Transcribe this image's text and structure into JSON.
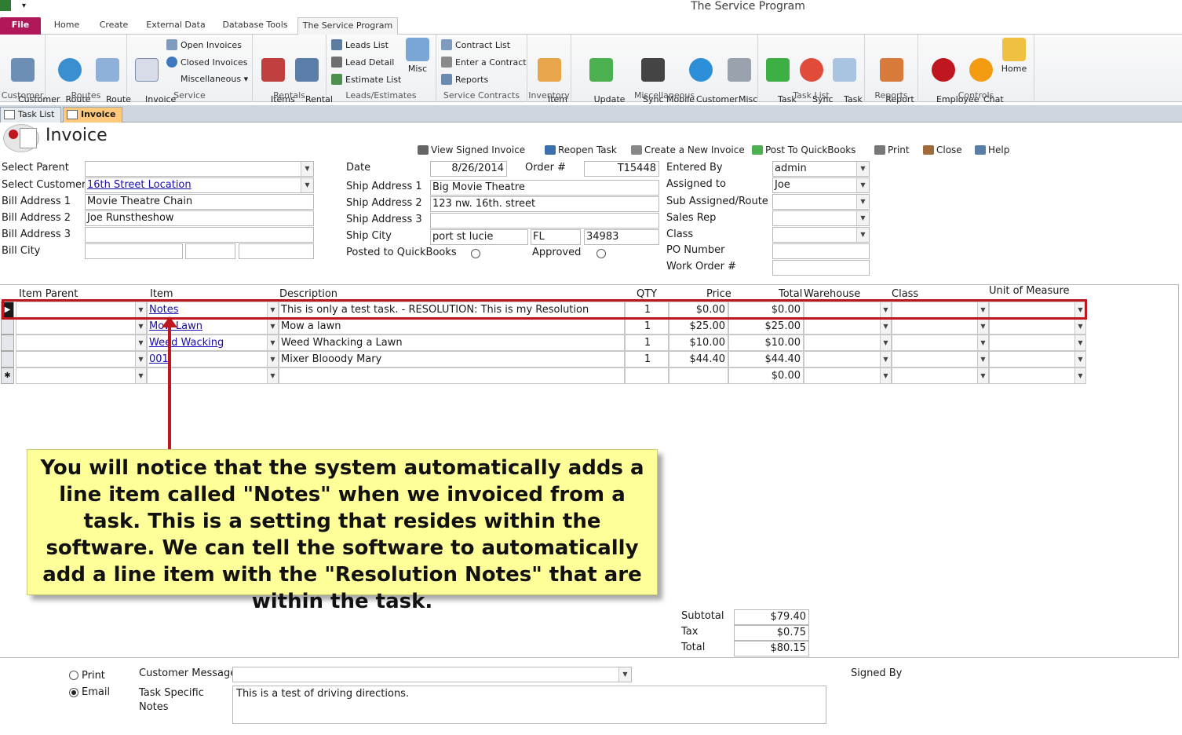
{
  "window": {
    "title": "The Service Program"
  },
  "ribbon_tabs": [
    "File",
    "Home",
    "Create",
    "External Data",
    "Database Tools",
    "The Service Program"
  ],
  "ribbon": {
    "customer": {
      "label": "Customer",
      "btn": "Customer\nInfo ▾"
    },
    "routes": {
      "label": "Routes",
      "schedule": "Route\nSchedule",
      "info": "Route\nInfo ▾"
    },
    "service": {
      "label": "Service",
      "invoice_entry": "Invoice\nEntry",
      "open_invoices": "Open Invoices",
      "closed_invoices": "Closed Invoices",
      "misc": "Miscellaneous ▾"
    },
    "rentals": {
      "label": "Rentals",
      "items_rented": "Items\nRented",
      "rental_info": "Rental\nInfo ▾"
    },
    "leads": {
      "label": "Leads/Estimates",
      "leads_list": "Leads List",
      "lead_detail": "Lead Detail",
      "estimate_list": "Estimate List",
      "misc": "Misc"
    },
    "contracts": {
      "label": "Service Contracts",
      "contract_list": "Contract List",
      "enter_contract": "Enter a Contract",
      "reports": "Reports"
    },
    "inventory": {
      "label": "Inventory",
      "item_info": "Item\nInfo ▾"
    },
    "miscellaneous": {
      "label": "Miscellaneous",
      "update_qb": "Update\nQuickBooks",
      "sync_mobile": "Sync Mobile\nDevices",
      "customer_portal": "Customer\nPortal",
      "misc_info": "Misc\nInfo ▾"
    },
    "tasklist": {
      "label": "Task List",
      "task_entry": "Task\nEntry",
      "sync_gcals": "Sync\ngCals",
      "task_info": "Task\nInfo ▾"
    },
    "reports": {
      "label": "Reports",
      "report_selection": "Report\nSelection ▾"
    },
    "controls": {
      "label": "Controls",
      "employee_locator": "Employee\nLocator",
      "chat_now": "Chat\nNow",
      "home": "Home"
    }
  },
  "doc_tabs": [
    "Task List",
    "Invoice"
  ],
  "form": {
    "title": "Invoice",
    "toolbar": {
      "view_signed": "View Signed Invoice",
      "reopen_task": "Reopen Task",
      "create_new": "Create a New Invoice",
      "post_qb": "Post To QuickBooks",
      "print": "Print",
      "close": "Close",
      "help": "Help"
    },
    "labels": {
      "select_parent": "Select Parent",
      "select_customer": "Select Customer",
      "bill1": "Bill Address 1",
      "bill2": "Bill Address 2",
      "bill3": "Bill Address 3",
      "bill_city": "Bill City",
      "date": "Date",
      "order": "Order #",
      "ship1": "Ship Address 1",
      "ship2": "Ship Address 2",
      "ship3": "Ship Address 3",
      "ship_city": "Ship City",
      "posted_qb": "Posted to QuickBooks",
      "approved": "Approved",
      "entered_by": "Entered By",
      "assigned_to": "Assigned to",
      "sub_assigned": "Sub Assigned/Route",
      "sales_rep": "Sales Rep",
      "class": "Class",
      "po_number": "PO Number",
      "work_order": "Work Order #"
    },
    "values": {
      "select_parent": "",
      "select_customer": "16th Street Location",
      "bill1": "Movie Theatre Chain",
      "bill2": "Joe Runstheshow",
      "bill3": "",
      "date": "8/26/2014",
      "order": "T15448",
      "ship1": "Big Movie Theatre",
      "ship2": "123 nw. 16th. street",
      "ship3": "",
      "ship_city": "port st lucie",
      "ship_state": "FL",
      "ship_zip": "34983",
      "entered_by": "admin",
      "assigned_to": "Joe"
    }
  },
  "grid": {
    "headers": [
      "Item Parent",
      "Item",
      "Description",
      "QTY",
      "Price",
      "Total",
      "Warehouse",
      "Class",
      "Unit of Measure"
    ],
    "rows": [
      {
        "item": "Notes",
        "description": "This is only a test task. - RESOLUTION: This is my Resolution",
        "qty": "1",
        "price": "$0.00",
        "total": "$0.00"
      },
      {
        "item": "Mow Lawn",
        "description": "Mow a lawn",
        "qty": "1",
        "price": "$25.00",
        "total": "$25.00"
      },
      {
        "item": "Weed Wacking",
        "description": "Weed Whacking a Lawn",
        "qty": "1",
        "price": "$10.00",
        "total": "$10.00"
      },
      {
        "item": "001",
        "description": "Mixer Blooody Mary",
        "qty": "1",
        "price": "$44.40",
        "total": "$44.40"
      }
    ],
    "new_row_total": "$0.00",
    "new_row_marker": "✱"
  },
  "totals": {
    "subtotal_label": "Subtotal",
    "subtotal": "$79.40",
    "tax_label": "Tax",
    "tax": "$0.75",
    "total_label": "Total",
    "total": "$80.15"
  },
  "footer": {
    "print": "Print",
    "email": "Email",
    "customer_message": "Customer Message",
    "task_notes_label": "Task Specific\nNotes",
    "task_notes": "This is a test of driving directions.",
    "signed_by": "Signed By"
  },
  "callout": {
    "text": "You will notice that the system automatically adds a line item called \"Notes\" when we invoiced from a task.  This is a setting that resides within the software.  We can tell the software to automatically add a line item with the \"Resolution Notes\" that are within the task."
  },
  "colors": {
    "file_tab": "#b0185a",
    "active_doc_tab": "#ffc87a",
    "callout_bg": "#ffff99",
    "annotation_red": "#c0161f",
    "link": "#1a0dab"
  }
}
